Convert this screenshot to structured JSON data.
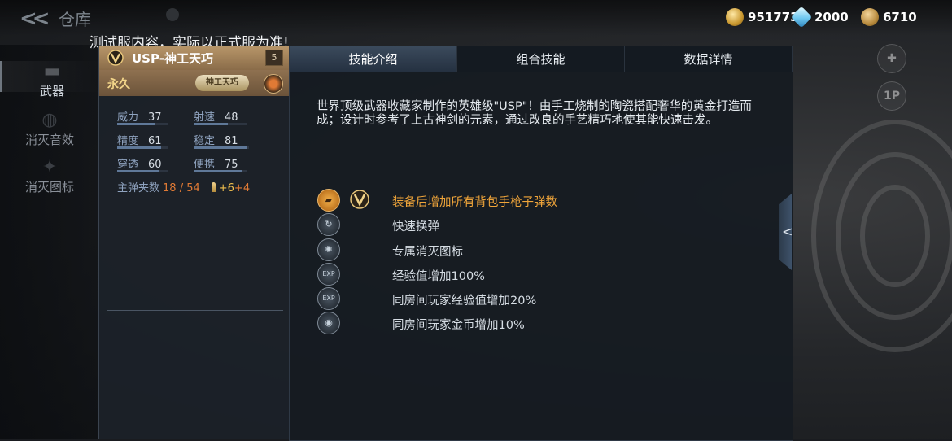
{
  "header": {
    "back_icon": "double-chevron-left-icon",
    "title": "仓库",
    "currencies": [
      {
        "icon": "gold-coin-icon",
        "value": "951773"
      },
      {
        "icon": "diamond-icon",
        "value": "2000"
      },
      {
        "icon": "token-icon",
        "value": "6710"
      }
    ]
  },
  "notice": "测试服内容，实际以正式服为准!",
  "side_nav": {
    "items": [
      {
        "label": "武器",
        "active": true
      },
      {
        "label": "消灭音效",
        "active": false
      },
      {
        "label": "消灭图标",
        "active": false
      }
    ]
  },
  "weapon": {
    "name": "USP-神工天巧",
    "level": "5",
    "duration": "永久",
    "badge": "神工天巧",
    "stats": [
      {
        "label": "威力",
        "value": "37"
      },
      {
        "label": "射速",
        "value": "48"
      },
      {
        "label": "精度",
        "value": "61"
      },
      {
        "label": "稳定",
        "value": "81"
      },
      {
        "label": "穿透",
        "value": "60"
      },
      {
        "label": "便携",
        "value": "75"
      }
    ],
    "magazine": {
      "label": "主弹夹数",
      "value": "18 / 54",
      "bonus_a": "+6",
      "bonus_b": "+4"
    }
  },
  "detail": {
    "tabs": [
      "技能介绍",
      "组合技能",
      "数据详情"
    ],
    "active_tab": 0,
    "description": "世界顶级武器收藏家制作的英雄级\"USP\"！由手工烧制的陶瓷搭配奢华的黄金打造而成；设计时参考了上古神剑的元素，通过改良的手艺精巧地使其能快速击发。",
    "skills": [
      {
        "icon": "pistol-icon",
        "text": "装备后增加所有背包手枪子弹数",
        "highlight": true
      },
      {
        "icon": "reload-icon",
        "text": "快速换弹",
        "highlight": false
      },
      {
        "icon": "kill-icon-icon",
        "text": "专属消灭图标",
        "highlight": false
      },
      {
        "icon": "exp-icon",
        "text": "经验值增加100%",
        "highlight": false
      },
      {
        "icon": "team-exp-icon",
        "text": "同房间玩家经验值增加20%",
        "highlight": false
      },
      {
        "icon": "team-gold-icon",
        "text": "同房间玩家金币增加10%",
        "highlight": false
      }
    ]
  },
  "hud": {
    "player_label": "1P"
  }
}
